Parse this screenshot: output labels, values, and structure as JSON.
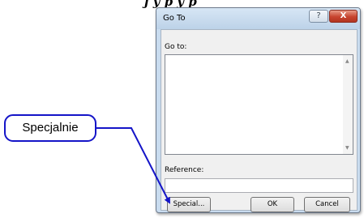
{
  "header_fragment": "j y   p y     p",
  "dialog": {
    "title": "Go To",
    "help_glyph": "?",
    "close_glyph": "X",
    "goto_label": "Go to:",
    "reference_label": "Reference:",
    "reference_value": "",
    "buttons": {
      "special": "Special...",
      "ok": "OK",
      "cancel": "Cancel"
    }
  },
  "callout": {
    "text": "Specjalnie",
    "color": "#1515c8"
  }
}
